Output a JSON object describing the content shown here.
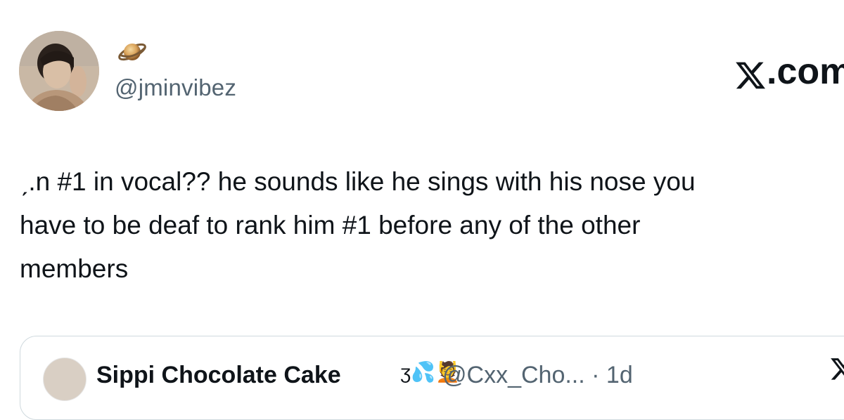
{
  "post": {
    "avatar_icon": "profile-photo",
    "display_name_emoji": "🪐",
    "handle": "@jminvibez",
    "text_lines": [
      "ˏ.n #1 in vocal?? he sounds like he sings with his nose you",
      "have to be deaf to rank him #1 before any of the other",
      "members"
    ]
  },
  "brand": {
    "logo_icon": "x-logo",
    "suffix": ".com"
  },
  "quoted_post": {
    "avatar_icon": "profile-photo",
    "name": "Sippi Chocolate Cake",
    "emoji": "ʒ💦💆",
    "handle": "@Cxx_Cho... · 1d",
    "more_icon": "x-logo"
  },
  "colors": {
    "text_primary": "#0f1419",
    "text_secondary": "#536471",
    "border": "#cfd9de",
    "background": "#ffffff"
  }
}
